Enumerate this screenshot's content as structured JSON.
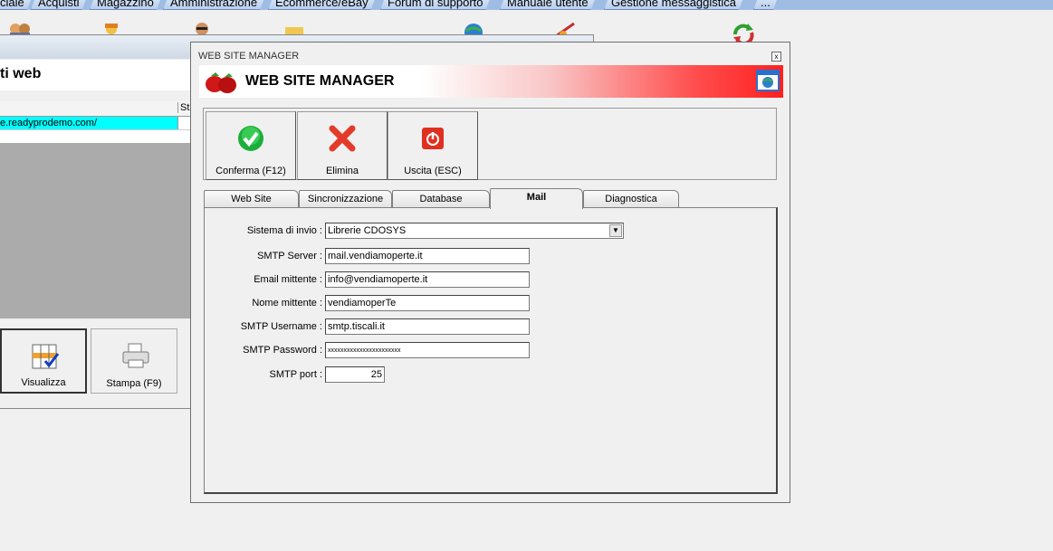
{
  "menu": {
    "items": [
      "ciale",
      "Acquisti",
      "Magazzino",
      "Amministrazione",
      "Ecommerce/eBay",
      "Forum di supporto",
      "Manuale utente",
      "Gestione messaggistica",
      "..."
    ]
  },
  "background_window": {
    "title_fragment": "ti web",
    "grid_header": "St",
    "grid_row": "e.readyprodemo.com/",
    "buttons": [
      {
        "label": "Visualizza",
        "icon": "grid-check-icon"
      },
      {
        "label": "Stampa (F9)",
        "icon": "printer-icon"
      }
    ]
  },
  "dialog": {
    "window_title": "WEB SITE MANAGER",
    "banner_title": "WEB SITE MANAGER",
    "close_glyph": "x",
    "toolbar": [
      {
        "label": "Conferma (F12)",
        "icon": "check-icon"
      },
      {
        "label": "Elimina",
        "icon": "delete-x-icon"
      },
      {
        "label": "Uscita (ESC)",
        "icon": "exit-power-icon"
      }
    ],
    "tabs": [
      {
        "label": "Web Site",
        "active": false
      },
      {
        "label": "Sincronizzazione",
        "active": false
      },
      {
        "label": "Database",
        "active": false
      },
      {
        "label": "Mail",
        "active": true
      },
      {
        "label": "Diagnostica",
        "active": false
      }
    ],
    "mail": {
      "sistema_label": "Sistema di invio :",
      "sistema_value": "Librerie CDOSYS",
      "server_label": "SMTP Server :",
      "server_value": "mail.vendiamoperte.it",
      "mittente_email_label": "Email mittente :",
      "mittente_email_value": "info@vendiamoperte.it",
      "mittente_nome_label": "Nome mittente :",
      "mittente_nome_value": "vendiamoperTe",
      "username_label": "SMTP Username :",
      "username_value": "smtp.tiscali.it",
      "password_label": "SMTP Password :",
      "password_value": "xxxxxxxxxxxxxxxxxxxxxxx",
      "port_label": "SMTP port :",
      "port_value": "25"
    }
  },
  "colors": {
    "banner_red": "#ff2020",
    "cyan_row": "#00ffff",
    "menubar": "#9fbde2"
  }
}
